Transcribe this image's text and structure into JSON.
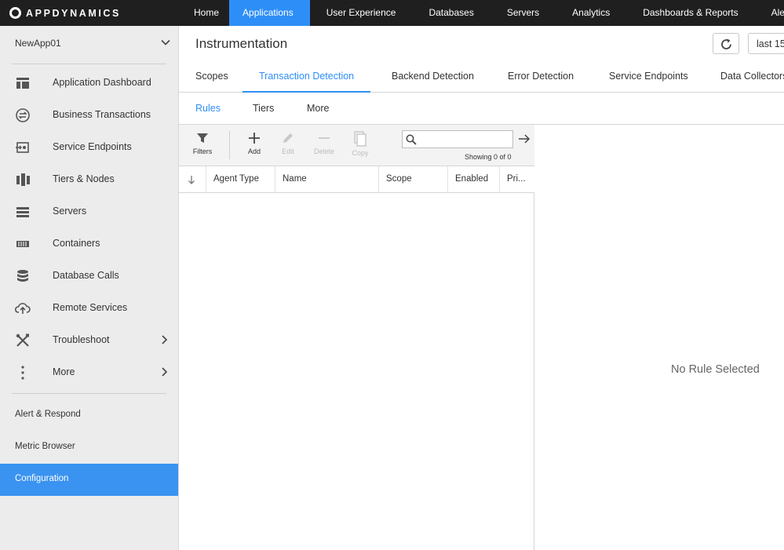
{
  "topbar": {
    "logo_text": "APPDYNAMICS",
    "nav": [
      {
        "label": "Home"
      },
      {
        "label": "Applications",
        "active": true
      },
      {
        "label": "User Experience"
      },
      {
        "label": "Databases"
      },
      {
        "label": "Servers"
      },
      {
        "label": "Analytics"
      },
      {
        "label": "Dashboards & Reports"
      },
      {
        "label": "Alert &"
      }
    ]
  },
  "sidebar": {
    "app_name": "NewApp01",
    "items": [
      {
        "label": "Application Dashboard",
        "icon": "dashboard-icon"
      },
      {
        "label": "Business Transactions",
        "icon": "transactions-icon"
      },
      {
        "label": "Service Endpoints",
        "icon": "service-endpoint-icon"
      },
      {
        "label": "Tiers & Nodes",
        "icon": "tiers-nodes-icon"
      },
      {
        "label": "Servers",
        "icon": "servers-icon"
      },
      {
        "label": "Containers",
        "icon": "containers-icon"
      },
      {
        "label": "Database Calls",
        "icon": "database-icon"
      },
      {
        "label": "Remote Services",
        "icon": "cloud-upload-icon"
      },
      {
        "label": "Troubleshoot",
        "icon": "tools-icon",
        "has_children": true
      },
      {
        "label": "More",
        "icon": "more-vertical-icon",
        "has_children": true
      }
    ],
    "secondary": [
      {
        "label": "Alert & Respond"
      },
      {
        "label": "Metric Browser"
      },
      {
        "label": "Configuration",
        "active": true
      }
    ]
  },
  "main": {
    "title": "Instrumentation",
    "time_range": "last 15",
    "tabs": [
      {
        "label": "Scopes"
      },
      {
        "label": "Transaction Detection",
        "active": true
      },
      {
        "label": "Backend Detection"
      },
      {
        "label": "Error Detection"
      },
      {
        "label": "Service Endpoints"
      },
      {
        "label": "Data Collectors"
      }
    ],
    "subtabs": [
      {
        "label": "Rules",
        "active": true
      },
      {
        "label": "Tiers"
      },
      {
        "label": "More"
      }
    ],
    "toolbar": {
      "filters": "Filters",
      "add": "Add",
      "edit": "Edit",
      "delete": "Delete",
      "copy": "Copy",
      "search_value": "",
      "showing": "Showing 0 of 0"
    },
    "table": {
      "columns": [
        "Agent Type",
        "Name",
        "Scope",
        "Enabled",
        "Pri..."
      ],
      "rows": []
    },
    "detail_empty": "No Rule Selected"
  },
  "colors": {
    "accent": "#2e8ef7",
    "topbar_bg": "#1f1f1f",
    "sidebar_bg": "#ececec",
    "sidebar_active": "#3a93f0"
  }
}
